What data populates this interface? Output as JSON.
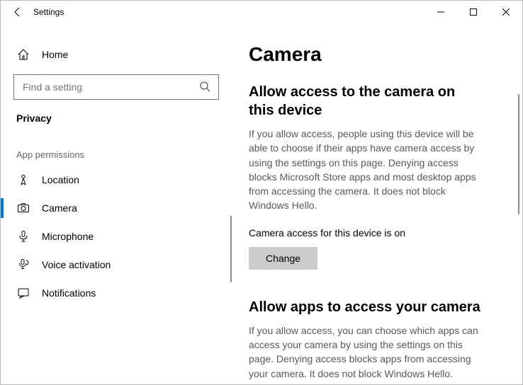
{
  "titlebar": {
    "title": "Settings"
  },
  "sidebar": {
    "home_label": "Home",
    "search_placeholder": "Find a setting",
    "category_label": "Privacy",
    "group_label": "App permissions",
    "items": [
      {
        "icon": "location",
        "label": "Location"
      },
      {
        "icon": "camera",
        "label": "Camera"
      },
      {
        "icon": "microphone",
        "label": "Microphone"
      },
      {
        "icon": "voice",
        "label": "Voice activation"
      },
      {
        "icon": "notifications",
        "label": "Notifications"
      }
    ]
  },
  "content": {
    "title": "Camera",
    "section1": {
      "heading": "Allow access to the camera on this device",
      "body": "If you allow access, people using this device will be able to choose if their apps have camera access by using the settings on this page. Denying access blocks Microsoft Store apps and most desktop apps from accessing the camera. It does not block Windows Hello.",
      "status": "Camera access for this device is on",
      "button": "Change"
    },
    "section2": {
      "heading": "Allow apps to access your camera",
      "body": "If you allow access, you can choose which apps can access your camera by using the settings on this page. Denying access blocks apps from accessing your camera. It does not block Windows Hello."
    }
  }
}
